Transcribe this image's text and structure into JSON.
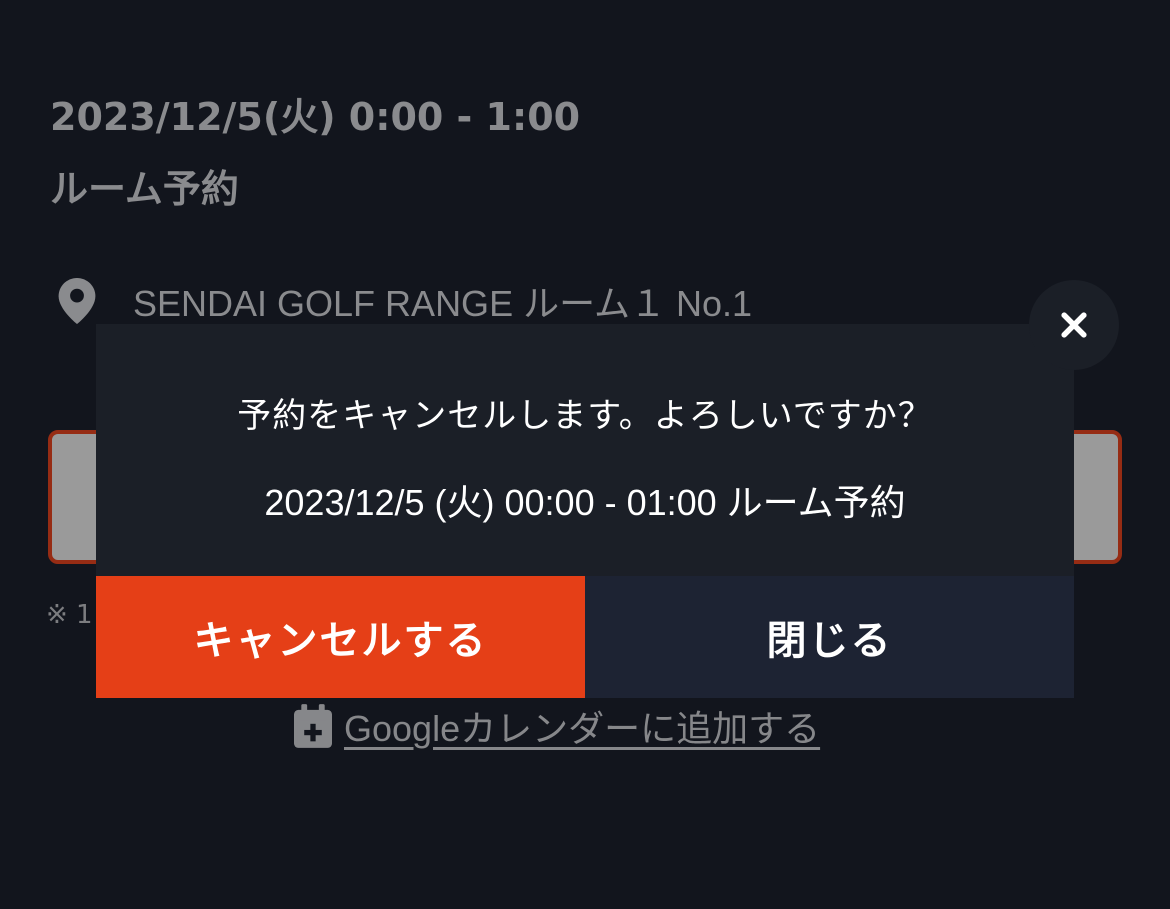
{
  "booking": {
    "datetime": "2023/12/5(火) 0:00 - 1:00",
    "type": "ルーム予約",
    "location": "SENDAI GOLF RANGE  ルーム１  No.1",
    "note": "※ 1"
  },
  "calendar_link": {
    "icon": "calendar-plus-icon",
    "label": "Googleカレンダーに追加する"
  },
  "modal": {
    "message": "予約をキャンセルします。よろしいですか？",
    "detail": "2023/12/5 (火) 00:00 - 01:00 ルーム予約",
    "confirm_label": "キャンセルする",
    "close_label": "閉じる",
    "close_icon": "close-icon"
  },
  "colors": {
    "background": "#12151d",
    "modal": "#1b1f27",
    "cancel_button": "#e53f17",
    "close_button": "#1d2333",
    "dimmed_text": "#8a8b8e"
  }
}
